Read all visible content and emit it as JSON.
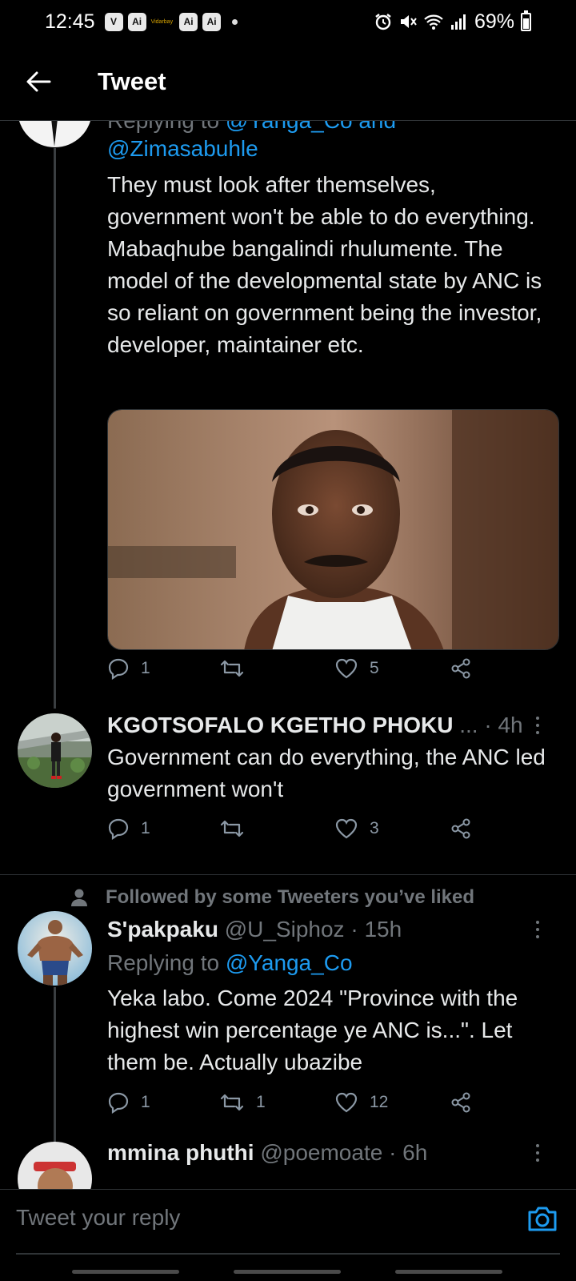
{
  "status_bar": {
    "time": "12:45",
    "badges": [
      "V",
      "Ai",
      "Ai",
      "Ai"
    ],
    "tiny_badge": "Vidarbay",
    "battery": "69%",
    "icons": [
      "alarm-icon",
      "mute-icon",
      "wifi-icon",
      "signal-icon",
      "battery-icon"
    ]
  },
  "header": {
    "title": "Tweet",
    "back_icon": "arrow-left-icon"
  },
  "tweets": [
    {
      "replying_label": "Replying to",
      "replying_handles_line1": "@Yanga_Co and",
      "replying_handles_line2": "@Zimasabuhle",
      "text": "They must look after themselves, government won't be able to do everything. Mabaqhube bangalindi rhulumente. The model of the developmental state by ANC is so reliant on government being the investor, developer, maintainer etc.",
      "replies": "1",
      "retweets": "",
      "likes": "5"
    },
    {
      "name": "KGOTSOFALO KGETHO PHOKU",
      "meta": "... · 4h",
      "text": "Government can do everything, the ANC led government won't",
      "replies": "1",
      "retweets": "",
      "likes": "3"
    },
    {
      "social_context": "Followed by some Tweeters you’ve liked",
      "name": "S'pakpaku",
      "handle": "@U_Siphoz",
      "time": "· 15h",
      "replying_label": "Replying to",
      "replying_handle": "@Yanga_Co",
      "text": "Yeka labo. Come 2024 \"Province with the highest win percentage ye ANC is...\". Let them be. Actually ubazibe",
      "replies": "1",
      "retweets": "1",
      "likes": "12"
    },
    {
      "name": "mmina phuthi",
      "handle": "@poemoate",
      "time": "· 6h"
    }
  ],
  "reply_bar": {
    "placeholder": "Tweet your reply",
    "camera_icon": "camera-icon"
  },
  "colors": {
    "background": "#000000",
    "accent": "#1d9bf0",
    "text": "#e7e9ea",
    "muted": "#71767b",
    "divider": "#2f3336"
  }
}
